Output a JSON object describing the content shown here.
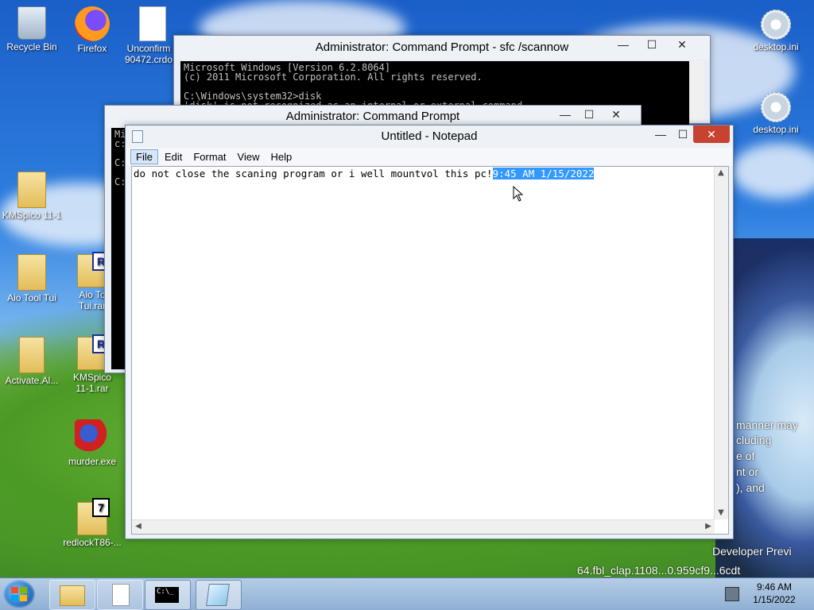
{
  "desktop": {
    "icons": [
      {
        "label": "Recycle Bin"
      },
      {
        "label": "Firefox"
      },
      {
        "label": "Unconfirm 90472.crdo"
      },
      {
        "label": "KMSpico 11-1"
      },
      {
        "label": "Aio Tool Tui"
      },
      {
        "label": "Aio To Tui.rar"
      },
      {
        "label": "Activate.Al..."
      },
      {
        "label": "KMSpico 11-1.rar"
      },
      {
        "label": "murder.exe"
      },
      {
        "label": "redlockT86-..."
      },
      {
        "label": "desktop.ini"
      },
      {
        "label": "desktop.ini"
      }
    ],
    "watermark": {
      "lines": [
        "manner may",
        "cluding",
        "e of",
        "nt or",
        "), and"
      ],
      "developer": "Developer Previ",
      "build": "64.fbl_clap.1108...0.959cf9...6cdt"
    }
  },
  "cmd_back": {
    "title": "Administrator: Command Prompt - sfc  /scannow",
    "console": "Microsoft Windows [Version 6.2.8064]\n(c) 2011 Microsoft Corporation. All rights reserved.\n\nC:\\Windows\\system32>disk\n'disk' is not recognized as an internal or external command,"
  },
  "cmd_front": {
    "title": "Administrator: Command Prompt",
    "console": "Mi\nc:\n\nC:\n\nC:"
  },
  "notepad": {
    "title": "Untitled - Notepad",
    "menu": [
      "File",
      "Edit",
      "Format",
      "View",
      "Help"
    ],
    "text": "do not close the scaning program or i well mountvol this pc!",
    "selected_text": "9:45 AM 1/15/2022"
  },
  "taskbar": {
    "time": "9:46 AM",
    "date": "1/15/2022",
    "cmd_label": "C:\\_"
  },
  "window_controls": {
    "minimize": "—",
    "maximize": "☐",
    "close": "✕"
  }
}
